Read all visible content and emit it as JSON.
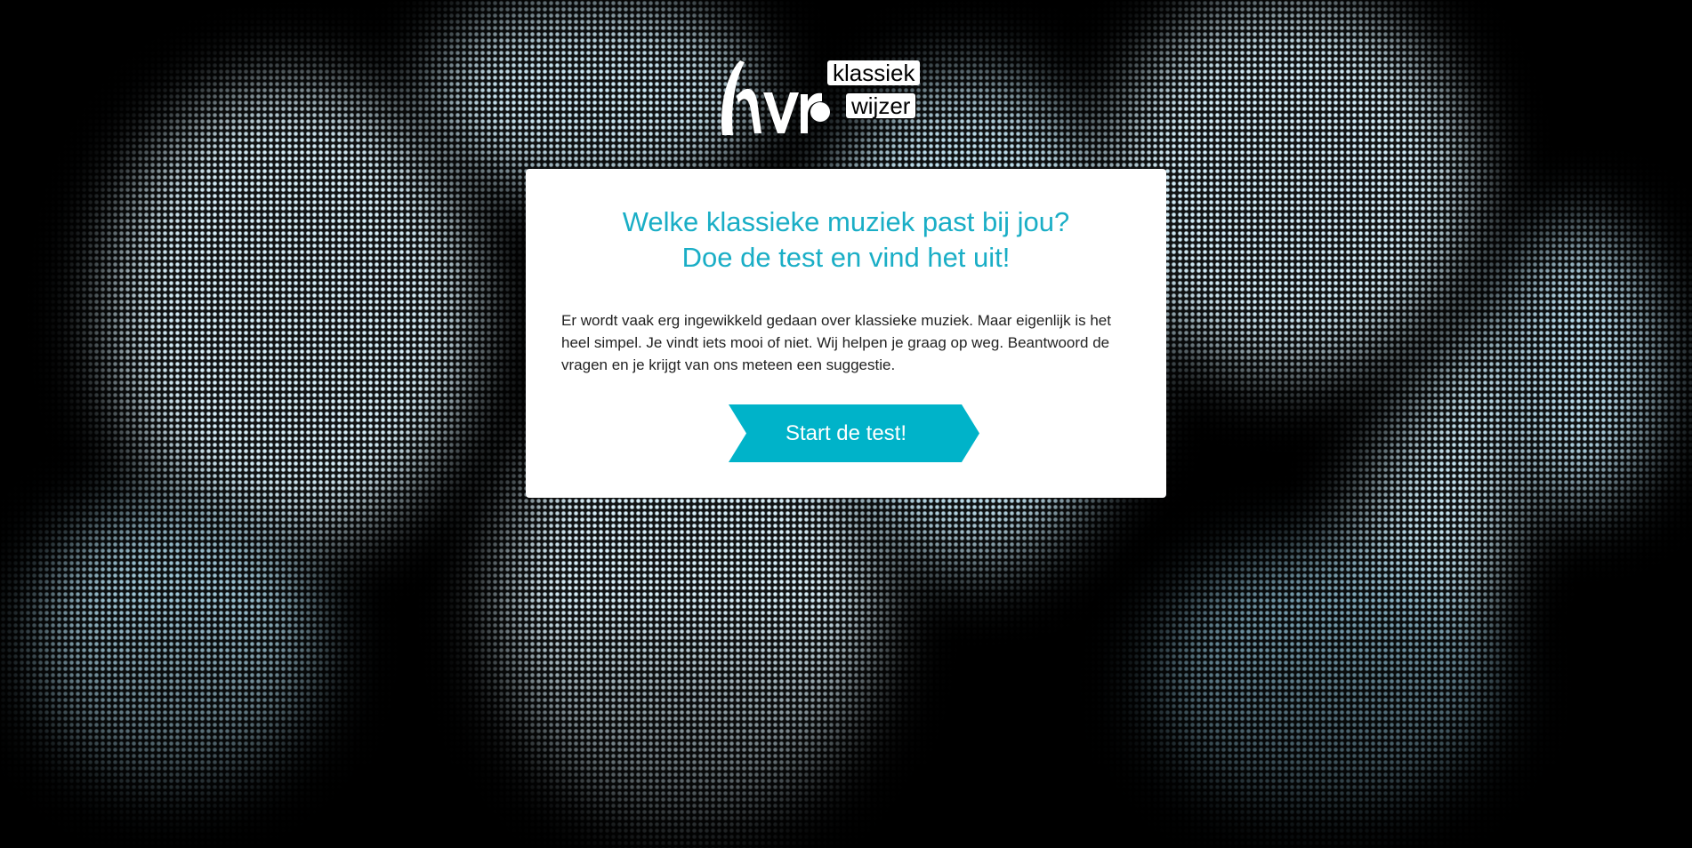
{
  "logo": {
    "line1": "klassiek",
    "line2": "wijzer"
  },
  "intro": {
    "title_line1": "Welke klassieke muziek past bij jou?",
    "title_line2": "Doe de test en vind het uit!",
    "body": "Er wordt vaak erg ingewikkeld gedaan over klassieke muziek. Maar eigenlijk is het heel simpel. Je vindt iets mooi of niet. Wij helpen je graag op weg. Beantwoord de vragen en je krijgt van ons meteen een suggestie.",
    "cta_label": "Start de test!"
  },
  "colors": {
    "accent": "#1aaec6",
    "cta": "#00b3c9",
    "halftone_light": "#cfeaf5",
    "background": "#000000"
  }
}
